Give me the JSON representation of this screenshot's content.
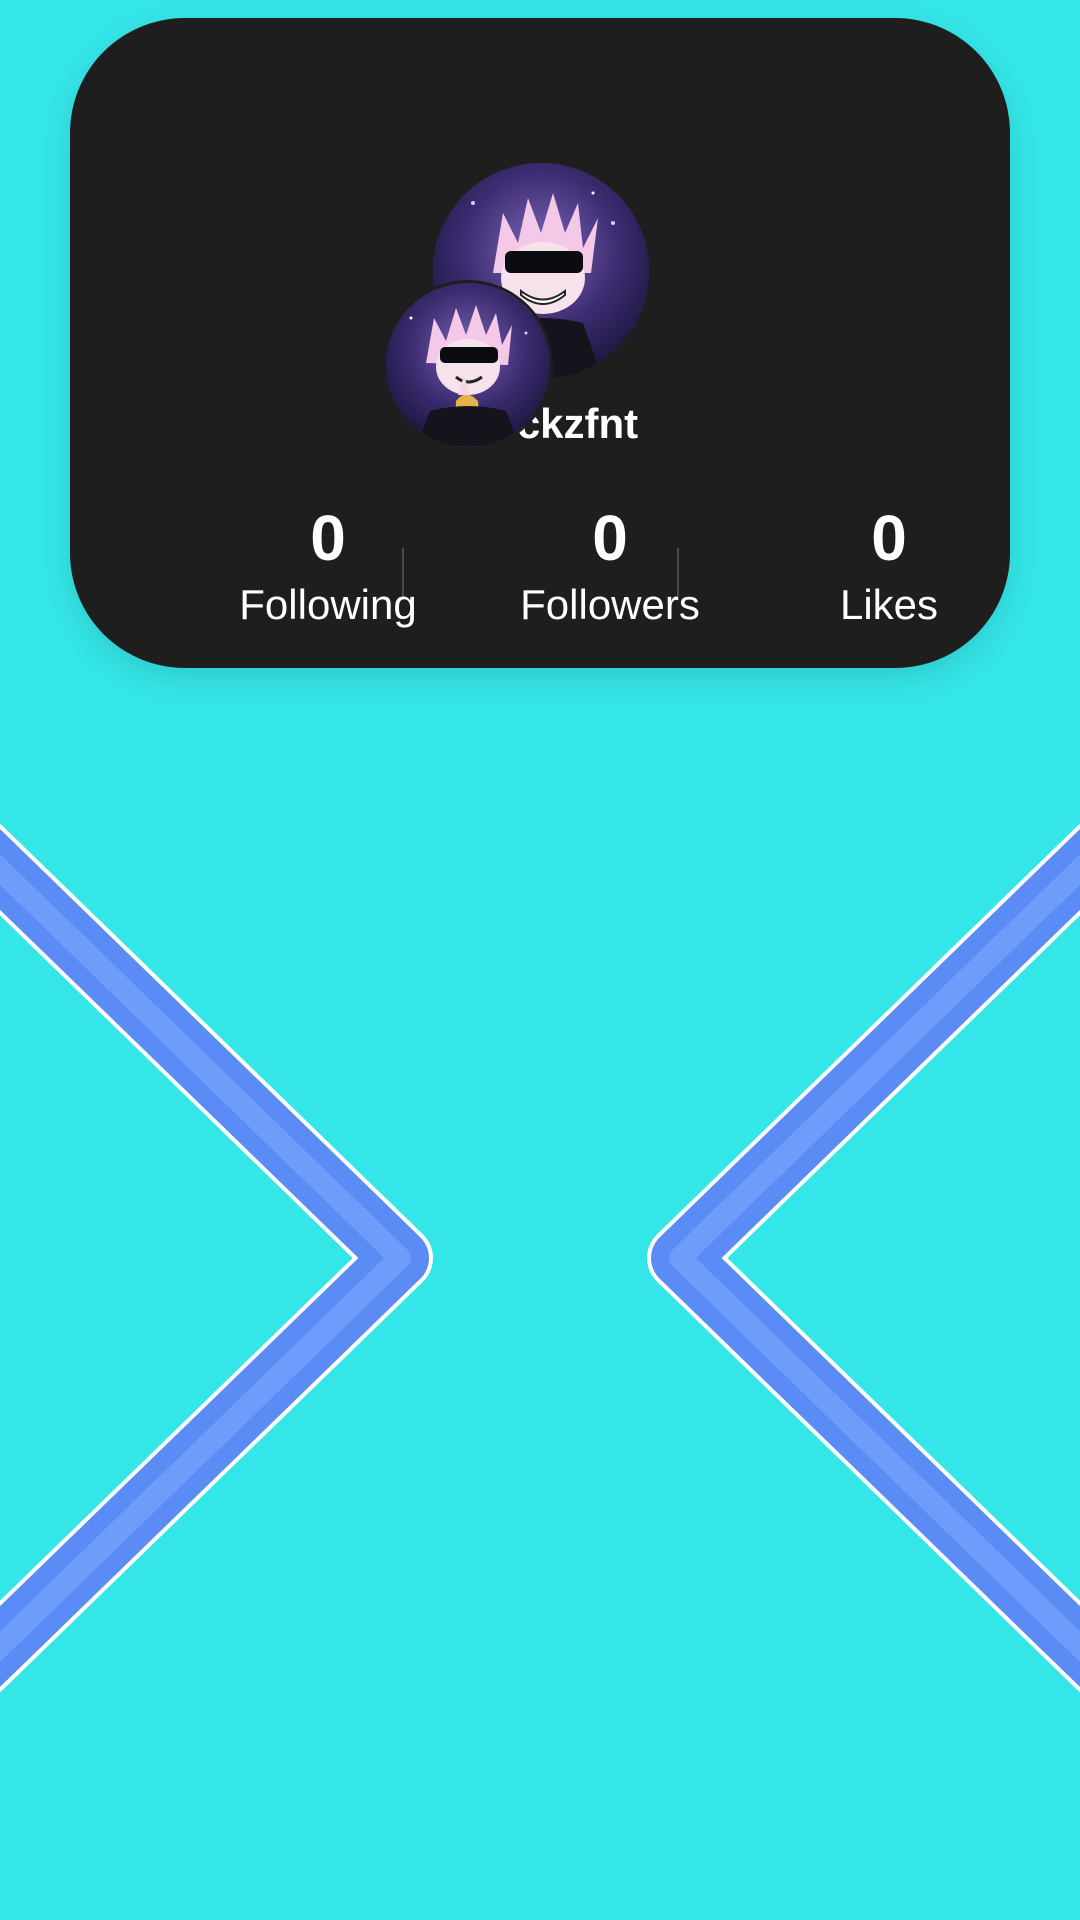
{
  "profile": {
    "username": "ckzfnt"
  },
  "stats": [
    {
      "count": "0",
      "label": "Following"
    },
    {
      "count": "0",
      "label": "Followers"
    },
    {
      "count": "0",
      "label": "Likes"
    }
  ],
  "colors": {
    "background": "#35e6e8",
    "card": "#1f1e1f",
    "chevron": "#5b8cf5",
    "chevron_outline": "#ffffff"
  },
  "icons": {
    "left": "chevron-right-icon",
    "right": "chevron-left-icon"
  }
}
